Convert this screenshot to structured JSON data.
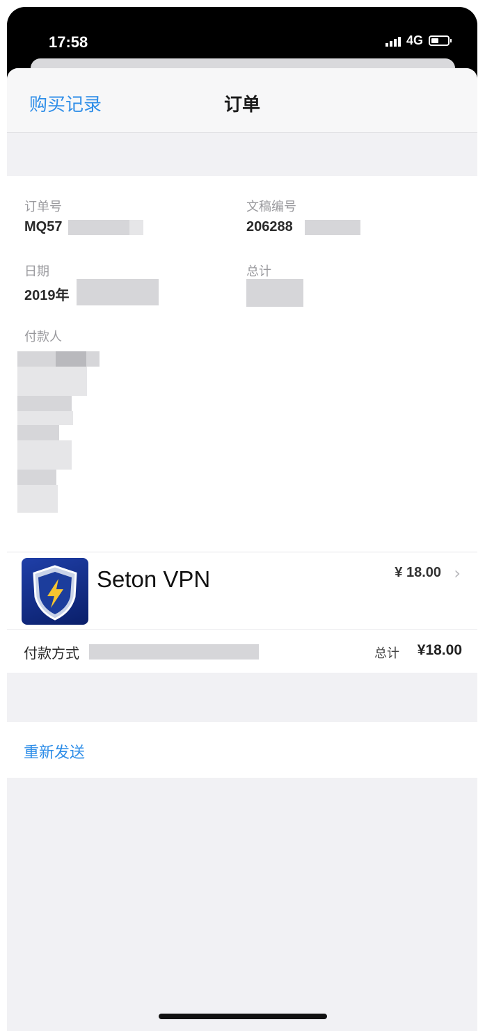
{
  "status_bar": {
    "time": "17:58",
    "network": "4G"
  },
  "nav": {
    "back_label": "购买记录",
    "title": "订单"
  },
  "order": {
    "order_id_label": "订单号",
    "order_id_value": "MQ57",
    "document_no_label": "文稿编号",
    "document_no_value": "206288",
    "date_label": "日期",
    "date_value": "2019年",
    "total_label": "总计",
    "payer_label": "付款人"
  },
  "item": {
    "app_name": "Seton VPN",
    "price": "¥ 18.00",
    "icon": "shield-lightning-icon"
  },
  "payment": {
    "method_label": "付款方式",
    "total_label": "总计",
    "total_value": "¥18.00"
  },
  "actions": {
    "resend_label": "重新发送"
  },
  "colors": {
    "link": "#2f8ee8",
    "background": "#f1f1f4"
  }
}
